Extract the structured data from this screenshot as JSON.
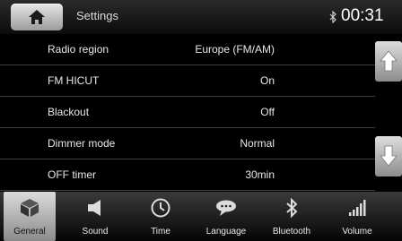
{
  "header": {
    "home_icon": "home-icon",
    "title": "Settings",
    "bluetooth_icon": "bluetooth-status-icon",
    "time": "00:31"
  },
  "settings": [
    {
      "label": "Radio region",
      "value": "Europe (FM/AM)"
    },
    {
      "label": "FM HICUT",
      "value": "On"
    },
    {
      "label": "Blackout",
      "value": "Off"
    },
    {
      "label": "Dimmer mode",
      "value": "Normal"
    },
    {
      "label": "OFF timer",
      "value": "30min"
    }
  ],
  "scroll": {
    "up_icon": "arrow-up-icon",
    "down_icon": "arrow-down-icon"
  },
  "tabs": [
    {
      "label": "General",
      "icon": "cube-icon",
      "active": true
    },
    {
      "label": "Sound",
      "icon": "speaker-icon",
      "active": false
    },
    {
      "label": "Time",
      "icon": "clock-icon",
      "active": false
    },
    {
      "label": "Language",
      "icon": "speech-bubble-icon",
      "active": false
    },
    {
      "label": "Bluetooth",
      "icon": "bluetooth-icon",
      "active": false
    },
    {
      "label": "Volume",
      "icon": "volume-bars-icon",
      "active": false
    }
  ],
  "colors": {
    "active_tab": "#c8c8c8",
    "background": "#000000",
    "text": "#e8e8e8"
  }
}
